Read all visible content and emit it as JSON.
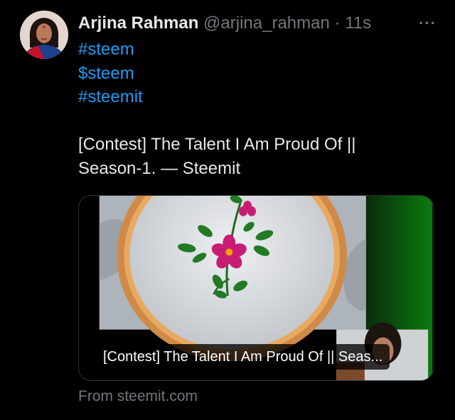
{
  "author": {
    "name": "Arjina Rahman",
    "handle": "@arjina_rahman",
    "separator": "·",
    "time": "11s",
    "more": "···"
  },
  "tweet": {
    "tags": [
      "#steem",
      "$steem",
      "#steemit"
    ],
    "text_lines": [
      "[Contest] The Talent I Am Proud Of ||",
      "Season-1. — Steemit"
    ]
  },
  "card": {
    "title": "[Contest] The Talent I Am Proud Of || Seas...",
    "source": "From steemit.com"
  },
  "colors": {
    "background": "#000000",
    "text": "#e7e9ea",
    "secondary": "#71767b",
    "link": "#1d9bf0",
    "border": "#2f3336"
  },
  "icons": {
    "more": "more-horizontal-icon"
  }
}
